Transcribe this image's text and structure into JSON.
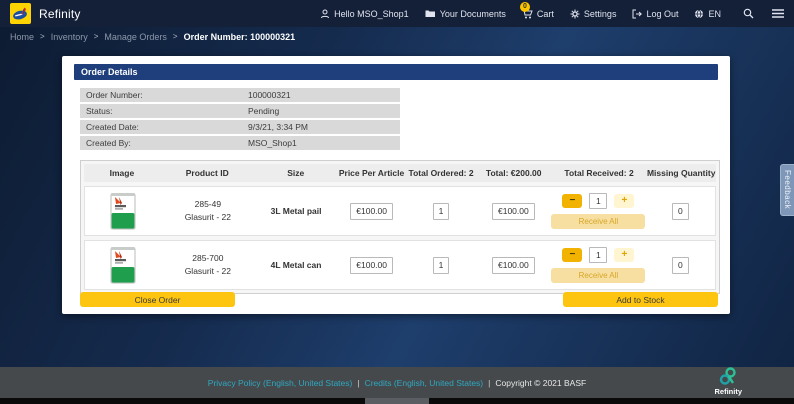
{
  "header": {
    "app_title": "Refinity",
    "greeting": "Hello MSO_Shop1",
    "documents_label": "Your Documents",
    "cart_label": "Cart",
    "cart_badge": "0",
    "settings_label": "Settings",
    "logout_label": "Log Out",
    "language": "EN"
  },
  "breadcrumb": {
    "separator": ">",
    "home": "Home",
    "inventory": "Inventory",
    "manage_orders": "Manage Orders",
    "current": "Order Number: 100000321"
  },
  "order_details": {
    "title": "Order Details",
    "fields": [
      {
        "label": "Order Number:",
        "value": "100000321"
      },
      {
        "label": "Status:",
        "value": "Pending"
      },
      {
        "label": "Created Date:",
        "value": "9/3/21, 3:34 PM"
      },
      {
        "label": "Created By:",
        "value": "MSO_Shop1"
      }
    ]
  },
  "items_table": {
    "headers": [
      "Image",
      "Product ID",
      "Size",
      "Price Per Article",
      "Total Ordered: 2",
      "Total: €200.00",
      "Total Received: 2",
      "Missing Quantity"
    ],
    "rows": [
      {
        "product_id": "285-49",
        "brand": "Glasurit - 22",
        "size": "3L Metal pail",
        "price": "€100.00",
        "ordered": "1",
        "total": "€100.00",
        "received_qty": "1",
        "missing": "0"
      },
      {
        "product_id": "285-700",
        "brand": "Glasurit - 22",
        "size": "4L Metal can",
        "price": "€100.00",
        "ordered": "1",
        "total": "€100.00",
        "received_qty": "1",
        "missing": "0"
      }
    ],
    "minus_label": "−",
    "plus_label": "+",
    "receive_all_label": "Receive All"
  },
  "actions": {
    "close_order": "Close Order",
    "add_to_stock": "Add to Stock"
  },
  "feedback_tab": "Feedback",
  "footer": {
    "privacy_link": "Privacy Policy (English, United States)",
    "credits_link": "Credits (English, United States)",
    "separator": "|",
    "copyright": "Copyright © 2021 BASF",
    "logo_label": "Refinity"
  },
  "colors": {
    "accent_yellow": "#fdc500",
    "panel_header_blue": "#1e3e7c",
    "link_teal": "#2fa8c0"
  }
}
